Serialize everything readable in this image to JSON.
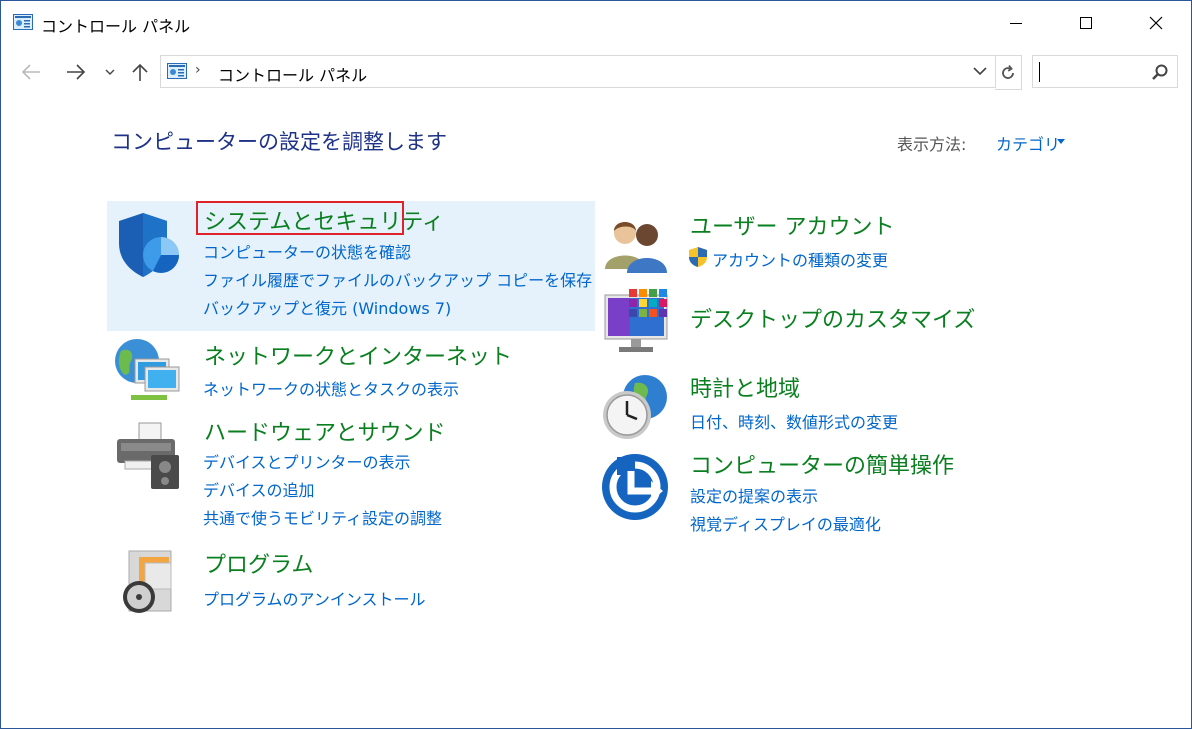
{
  "window": {
    "title": "コントロール パネル",
    "controls": {
      "minimize": "minimize-icon",
      "maximize": "maximize-icon",
      "close": "close-icon"
    }
  },
  "nav": {
    "back": "back-arrow-icon",
    "forward": "forward-arrow-icon",
    "recent": "chevron-down-icon",
    "up": "up-arrow-icon",
    "address": {
      "separator": "›",
      "path": "コントロール パネル"
    },
    "refresh": "refresh-icon",
    "search": {
      "value": "",
      "icon": "search-icon"
    }
  },
  "main": {
    "heading": "コンピューターの設定を調整します",
    "view_by": {
      "label": "表示方法:",
      "value": "カテゴリ"
    },
    "categories_left": [
      {
        "title": "システムとセキュリティ",
        "icon": "shield-icon",
        "links": [
          "コンピューターの状態を確認",
          "ファイル履歴でファイルのバックアップ コピーを保存",
          "バックアップと復元 (Windows 7)"
        ]
      },
      {
        "title": "ネットワークとインターネット",
        "icon": "network-globe-icon",
        "links": [
          "ネットワークの状態とタスクの表示"
        ]
      },
      {
        "title": "ハードウェアとサウンド",
        "icon": "printer-speaker-icon",
        "links": [
          "デバイスとプリンターの表示",
          "デバイスの追加",
          "共通で使うモビリティ設定の調整"
        ]
      },
      {
        "title": "プログラム",
        "icon": "program-disc-icon",
        "links": [
          "プログラムのアンインストール"
        ]
      }
    ],
    "categories_right": [
      {
        "title": "ユーザー アカウント",
        "icon": "users-icon",
        "links": [
          "アカウントの種類の変更"
        ]
      },
      {
        "title": "デスクトップのカスタマイズ",
        "icon": "monitor-tiles-icon",
        "links": []
      },
      {
        "title": "時計と地域",
        "icon": "clock-globe-icon",
        "links": [
          "日付、時刻、数値形式の変更"
        ]
      },
      {
        "title": "コンピューターの簡単操作",
        "icon": "ease-of-access-icon",
        "links": [
          "設定の提案の表示",
          "視覚ディスプレイの最適化"
        ]
      }
    ]
  },
  "colors": {
    "category_title": "#0a7f1f",
    "link": "#0066cc",
    "heading": "#1e3287",
    "highlight_bg": "#e5f1fb",
    "highlight_border": "#e0232a"
  }
}
